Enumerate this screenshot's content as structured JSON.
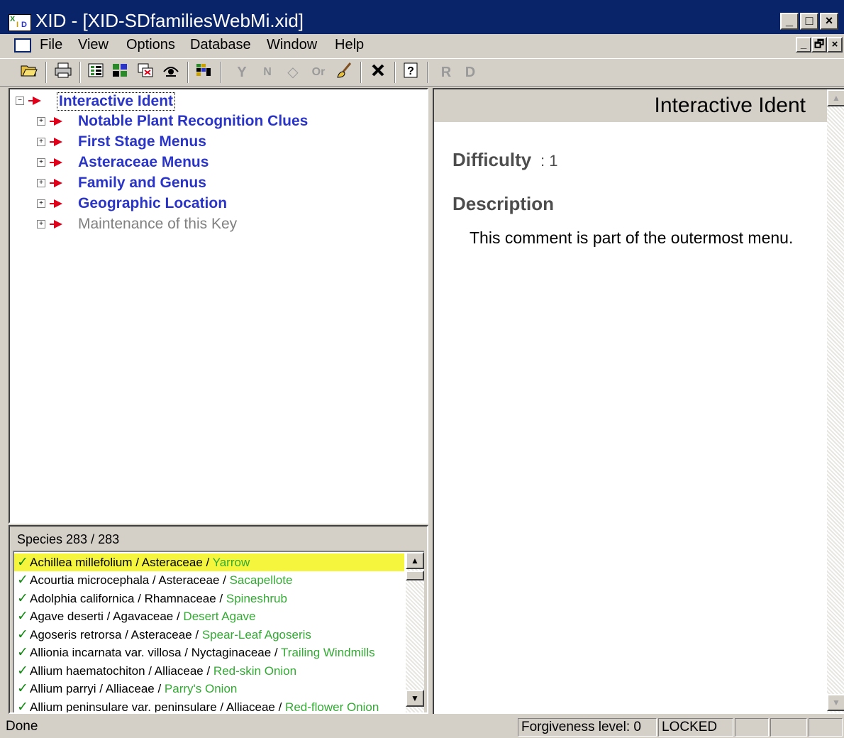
{
  "window": {
    "title": "XID - [XID-SDfamiliesWebMi.xid]",
    "icon": "xid-app-icon",
    "controls": {
      "minimize": "_",
      "maximize": "□",
      "close": "×",
      "restore": "🗗"
    }
  },
  "menubar": {
    "items": [
      "File",
      "View",
      "Options",
      "Database",
      "Window",
      "Help"
    ]
  },
  "toolbar": {
    "buttons": [
      "open-icon",
      "print-icon",
      "list-icon",
      "grid-icon",
      "compare-icon",
      "find-icon",
      "matrix-icon",
      "Y",
      "N",
      "eraser-icon",
      "Or",
      "brush-icon",
      "x-icon",
      "help-icon"
    ],
    "r_label": "R",
    "d_label": "D",
    "y_label": "Y",
    "n_label": "N",
    "or_label": "Or"
  },
  "tree": {
    "root": "Interactive Ident",
    "items": [
      "Notable Plant Recognition Clues",
      "First Stage Menus",
      "Asteraceae Menus",
      "Family and Genus",
      "Geographic Location",
      "Maintenance of this Key"
    ]
  },
  "species": {
    "header": "Species 283 / 283",
    "rows": [
      {
        "name": "Achillea millefolium / Asteraceae / ",
        "common": "Yarrow"
      },
      {
        "name": "Acourtia microcephala / Asteraceae / ",
        "common": "Sacapellote"
      },
      {
        "name": "Adolphia californica / Rhamnaceae / ",
        "common": "Spineshrub"
      },
      {
        "name": "Agave deserti / Agavaceae / ",
        "common": "Desert Agave"
      },
      {
        "name": "Agoseris retrorsa / Asteraceae / ",
        "common": "Spear-Leaf Agoseris"
      },
      {
        "name": "Allionia incarnata var. villosa / Nyctaginaceae / ",
        "common": "Trailing Windmills"
      },
      {
        "name": "Allium haematochiton / Alliaceae / ",
        "common": "Red-skin Onion"
      },
      {
        "name": "Allium parryi / Alliaceae / ",
        "common": "Parry's Onion"
      },
      {
        "name": "Allium peninsulare var. peninsulare / Alliaceae / ",
        "common": "Red-flower Onion"
      }
    ]
  },
  "detail": {
    "title": "Interactive Ident",
    "difficulty_label": "Difficulty",
    "difficulty_value": ": 1",
    "description_label": "Description",
    "description_text": "This comment is part of the outermost menu."
  },
  "status": {
    "message": "Done",
    "forgiveness": "Forgiveness level: 0",
    "lock": "LOCKED"
  },
  "colors": {
    "titlebar": "#0a246a",
    "node_text": "#2a35c8",
    "arrow": "#e0001a",
    "selected_row": "#f5f53d",
    "common_name": "#33aa33"
  }
}
